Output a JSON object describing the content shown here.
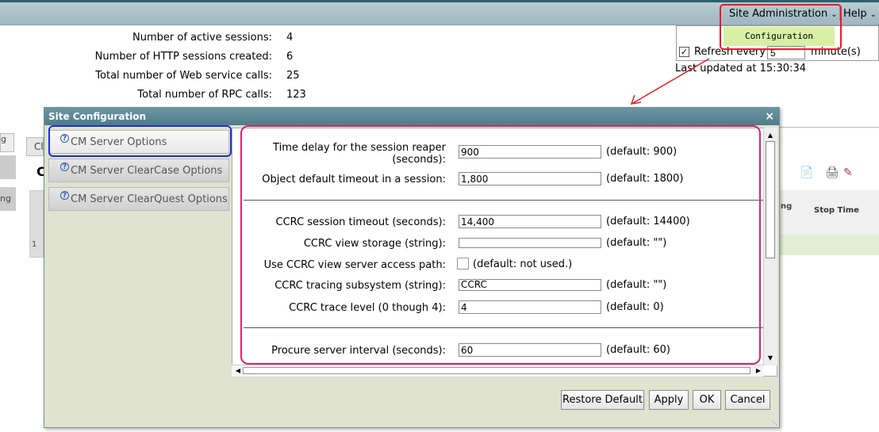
{
  "menubar": {
    "site_admin_label": "Site Administration",
    "help_label": "Help"
  },
  "dropdown": {
    "configuration_label": "Configuration",
    "refresh_label": "Refresh every",
    "refresh_value": "5",
    "minutes_label": "minute(s)",
    "last_updated": "Last updated at 15:30:34"
  },
  "stats": [
    {
      "label": "Number of active sessions:",
      "value": "4"
    },
    {
      "label": "Number of HTTP sessions created:",
      "value": "6"
    },
    {
      "label": "Total number of Web service calls:",
      "value": "25"
    },
    {
      "label": "Total number of RPC calls:",
      "value": "123"
    }
  ],
  "background": {
    "left_tab1": "g",
    "left_tab3": "ng",
    "tab_partial": "Cl",
    "heading_partial": "C",
    "row_number": "1",
    "col_partial": "ng",
    "stop_time_header": "Stop Time"
  },
  "modal": {
    "title": "Site Configuration",
    "close_label": "×",
    "nav": [
      {
        "label": "CM Server Options"
      },
      {
        "label": "CM Server ClearCase Options"
      },
      {
        "label": "CM Server ClearQuest Options"
      }
    ],
    "fields": [
      {
        "label": "Time delay for the session reaper (seconds):",
        "value": "900",
        "default": "(default: 900)"
      },
      {
        "label": "Object default timeout in a session:",
        "value": "1,800",
        "default": "(default: 1800)"
      },
      {
        "label": "CCRC session timeout (seconds):",
        "value": "14,400",
        "default": "(default: 14400)"
      },
      {
        "label": "CCRC view storage (string):",
        "value": "",
        "default": "(default: \"\")"
      },
      {
        "label": "Use CCRC view server access path:",
        "value": "",
        "default": "(default: not used.)"
      },
      {
        "label": "CCRC tracing subsystem (string):",
        "value": "CCRC",
        "default": "(default: \"\")"
      },
      {
        "label": "CCRC trace level (0 though 4):",
        "value": "4",
        "default": "(default: 0)"
      },
      {
        "label": "Procure server interval (seconds):",
        "value": "60",
        "default": "(default: 60)"
      }
    ],
    "buttons": {
      "restore": "Restore Default",
      "apply": "Apply",
      "ok": "OK",
      "cancel": "Cancel"
    }
  },
  "colors": {
    "highlight_red": "#e0202a",
    "highlight_blue": "#1c2fd6",
    "highlight_pink": "#d8236f",
    "config_green": "#d7f0a4"
  }
}
